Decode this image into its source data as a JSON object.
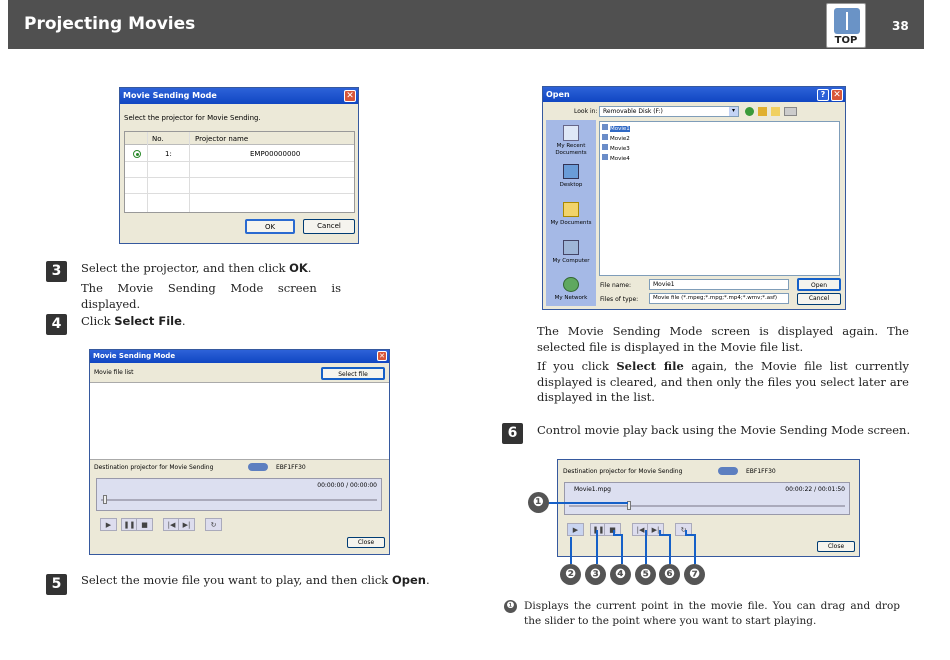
{
  "header": {
    "title": "Projecting Movies",
    "page": "38",
    "top_label": "TOP"
  },
  "dlg1": {
    "title": "Movie Sending Mode",
    "prompt": "Select the projector for Movie Sending.",
    "col_no": "No.",
    "col_name": "Projector name",
    "row_no": "1:",
    "row_name": "EMP00000000",
    "ok": "OK",
    "cancel": "Cancel"
  },
  "step3": {
    "num": "3",
    "pre": "Select the projector, and then click",
    "bold": "OK",
    "post": ".",
    "sub": "The Movie Sending Mode screen is displayed."
  },
  "step4": {
    "num": "4",
    "pre": "Click",
    "bold": "Select File",
    "post": "."
  },
  "dlg2": {
    "title": "Movie Sending Mode",
    "list_label": "Movie file list",
    "select_file": "Select file",
    "dest_label": "Destination projector for Movie Sending",
    "proj": "EBF1FF30",
    "time": "00:00:00 / 00:00:00",
    "close": "Close"
  },
  "step5": {
    "num": "5",
    "pre": "Select the movie file you want to play, and then click",
    "bold": "Open",
    "post": "."
  },
  "open": {
    "title": "Open",
    "look_in_label": "Look in:",
    "look_in": "Removable Disk (F:)",
    "places": [
      "My Recent Documents",
      "Desktop",
      "My Documents",
      "My Computer",
      "My Network"
    ],
    "files": [
      "Movie1",
      "Movie2",
      "Movie3",
      "Movie4"
    ],
    "file_name_label": "File name:",
    "file_name": "Movie1",
    "file_type_label": "Files of type:",
    "file_type": "Movie file (*.mpeg;*.mpg;*.mp4;*.wmv;*.asf)",
    "open_btn": "Open",
    "cancel_btn": "Cancel"
  },
  "right": {
    "p1": "The Movie Sending Mode screen is displayed again. The selected file is displayed in the Movie file list.",
    "p2_pre": "If you click",
    "p2_bold": "Select file",
    "p2_post": "again, the Movie file list currently displayed is cleared, and then only the files you select later are displayed in the list."
  },
  "step6": {
    "num": "6",
    "text": "Control movie play back using the Movie Sending Mode screen."
  },
  "dlg3": {
    "dest_label": "Destination projector for Movie Sending",
    "proj": "EBF1FF30",
    "file": "Movie1.mpg",
    "time": "00:00:22 / 00:01:50",
    "close": "Close"
  },
  "callouts": [
    "❶",
    "❷",
    "❸",
    "❹",
    "❺",
    "❻",
    "❼"
  ],
  "note": {
    "marker": "❶",
    "text": "Displays the current point in the movie file. You can drag and drop the slider to the point where you want to start playing."
  }
}
